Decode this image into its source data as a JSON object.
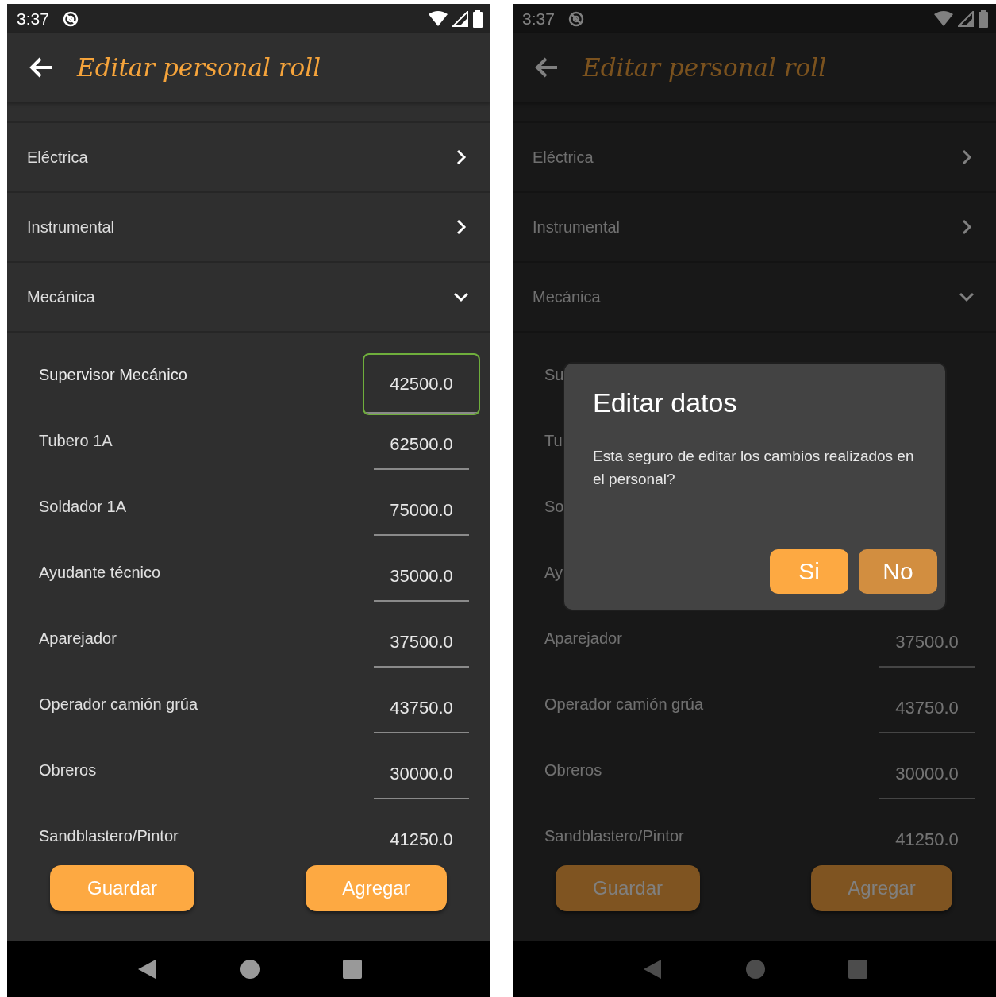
{
  "screens": [
    {
      "status_bar": {
        "time": "3:37"
      },
      "app_bar": {
        "title": "Editar personal roll"
      },
      "dimmed": false,
      "categories": [
        {
          "label": "Eléctrica",
          "expanded": false
        },
        {
          "label": "Instrumental",
          "expanded": false
        },
        {
          "label": "Mecánica",
          "expanded": true
        }
      ],
      "items": [
        {
          "label": "Supervisor Mecánico",
          "value": "42500.0",
          "focused": true
        },
        {
          "label": "Tubero 1A",
          "value": "62500.0",
          "focused": false
        },
        {
          "label": "Soldador 1A",
          "value": "75000.0",
          "focused": false
        },
        {
          "label": "Ayudante técnico",
          "value": "35000.0",
          "focused": false
        },
        {
          "label": "Aparejador",
          "value": "37500.0",
          "focused": false
        },
        {
          "label": "Operador camión grúa",
          "value": "43750.0",
          "focused": false
        },
        {
          "label": "Obreros",
          "value": "30000.0",
          "focused": false
        },
        {
          "label": "Sandblastero/Pintor",
          "value": "41250.0",
          "focused": false
        }
      ],
      "buttons": [
        "Guardar",
        "Agregar"
      ]
    },
    {
      "status_bar": {
        "time": "3:37"
      },
      "app_bar": {
        "title": "Editar personal roll"
      },
      "dimmed": true,
      "categories": [
        {
          "label": "Eléctrica",
          "expanded": false
        },
        {
          "label": "Instrumental",
          "expanded": false
        },
        {
          "label": "Mecánica",
          "expanded": true
        }
      ],
      "items": [
        {
          "label": "Su"
        },
        {
          "label": "Tu"
        },
        {
          "label": "So"
        },
        {
          "label": "Ay"
        },
        {
          "label": "Aparejador",
          "value": "37500.0",
          "focused": false
        },
        {
          "label": "Operador camión grúa",
          "value": "43750.0",
          "focused": false
        },
        {
          "label": "Obreros",
          "value": "30000.0",
          "focused": false
        },
        {
          "label": "Sandblastero/Pintor",
          "value": "41250.0",
          "focused": false
        }
      ],
      "buttons": [
        "Guardar",
        "Agregar"
      ],
      "dialog": {
        "title": "Editar datos",
        "message": "Esta seguro de editar los cambios realizados en el personal?",
        "buttons": [
          {
            "label": "Si",
            "kind": "confirm"
          },
          {
            "label": "No",
            "kind": "cancel"
          }
        ]
      }
    }
  ]
}
